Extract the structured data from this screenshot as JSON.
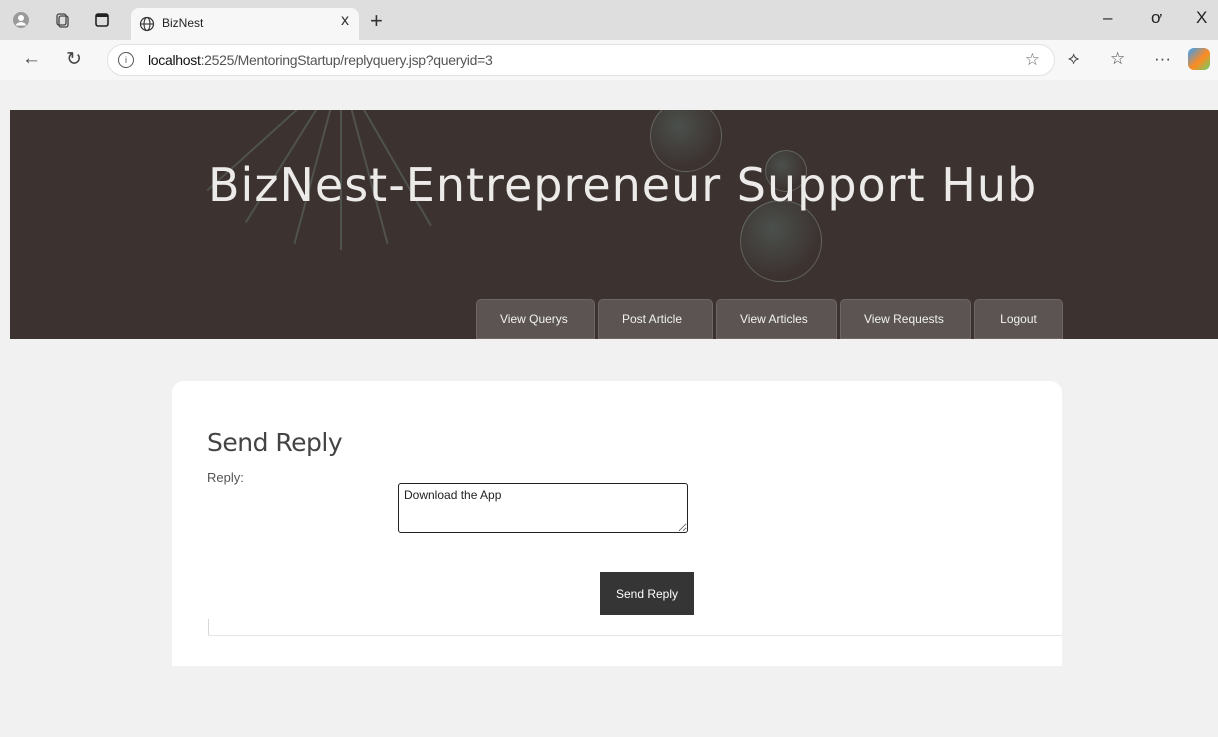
{
  "browser": {
    "tab_title": "BizNest",
    "tab_close": "x",
    "new_tab": "+",
    "url_host": "localhost",
    "url_path": ":2525/MentoringStartup/replyquery.jsp?queryid=3",
    "window_controls": {
      "minimize": "–",
      "restore": "ơ",
      "close": "X"
    }
  },
  "site": {
    "title": "BizNest-Entrepreneur Support Hub",
    "menu": [
      {
        "label": "View Querys"
      },
      {
        "label": "Post Article"
      },
      {
        "label": "View Articles"
      },
      {
        "label": "View Requests"
      },
      {
        "label": "Logout"
      }
    ]
  },
  "form": {
    "heading": "Send Reply",
    "reply_label": "Reply:",
    "reply_value": "Download the App",
    "submit_label": "Send Reply"
  },
  "colors": {
    "header_bg": "#3c3230",
    "menu_bg": "#5c5453",
    "button_bg": "#353535",
    "page_bg": "#f1f1f1"
  }
}
